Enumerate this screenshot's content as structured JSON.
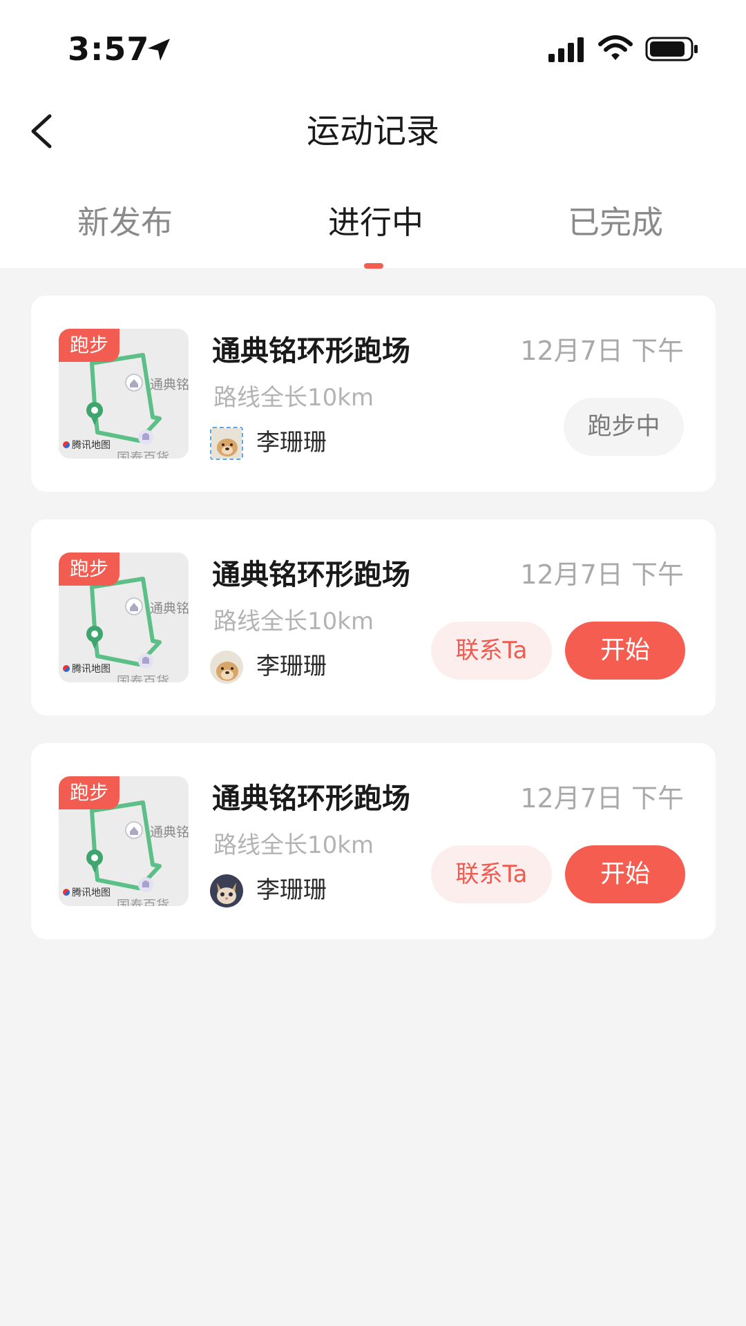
{
  "status_bar": {
    "time": "3:57",
    "icons": [
      "location-arrow-icon",
      "cellular-signal-icon",
      "wifi-icon",
      "battery-icon"
    ]
  },
  "header": {
    "title": "运动记录",
    "back_icon": "chevron-left-icon"
  },
  "tabs": [
    {
      "label": "新发布",
      "active": false
    },
    {
      "label": "进行中",
      "active": true
    },
    {
      "label": "已完成",
      "active": false
    }
  ],
  "colors": {
    "accent": "#f35c50",
    "background": "#f4f4f4",
    "route_green": "#5bbf87"
  },
  "records": [
    {
      "tag": "跑步",
      "map_brand": "腾讯地图",
      "map_poi": "通典铭",
      "map_poi2": "国泰百货",
      "venue": "通典铭环形跑场",
      "date": "12月7日 下午",
      "route": "路线全长10km",
      "user": "李珊珊",
      "status_label": "跑步中"
    },
    {
      "tag": "跑步",
      "map_brand": "腾讯地图",
      "map_poi": "通典铭",
      "map_poi2": "国泰百货",
      "venue": "通典铭环形跑场",
      "date": "12月7日 下午",
      "route": "路线全长10km",
      "user": "李珊珊",
      "contact_label": "联系Ta",
      "start_label": "开始"
    },
    {
      "tag": "跑步",
      "map_brand": "腾讯地图",
      "map_poi": "通典铭",
      "map_poi2": "国泰百货",
      "venue": "通典铭环形跑场",
      "date": "12月7日 下午",
      "route": "路线全长10km",
      "user": "李珊珊",
      "contact_label": "联系Ta",
      "start_label": "开始"
    }
  ]
}
